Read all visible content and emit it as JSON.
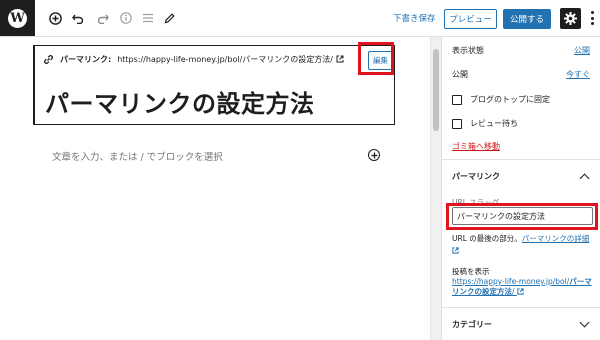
{
  "toolbar": {
    "logo_glyph": "W",
    "save_draft": "下書き保存",
    "preview": "プレビュー",
    "publish": "公開する"
  },
  "editor": {
    "permalink_label": "パーマリンク:",
    "permalink_url": "https://happy-life-money.jp/bol/パーマリンクの設定方法/",
    "edit_button": "編集",
    "post_title": "パーマリンクの設定方法",
    "block_placeholder": "文章を入力、または / でブロックを選択"
  },
  "sidebar": {
    "visibility_label": "表示状態",
    "visibility_value": "公開",
    "publish_label": "公開",
    "publish_value": "今すぐ",
    "stick_to_top": "ブログのトップに固定",
    "pending_review": "レビュー待ち",
    "move_to_trash": "ゴミ箱へ移動",
    "permalink_panel_title": "パーマリンク",
    "url_slug_label": "URL スラッグ",
    "url_slug_value": "パーマリンクの設定方法",
    "slug_help_prefix": "URL の最後の部分。",
    "slug_help_link": "パーマリンクの詳細",
    "view_post_label": "投稿を表示",
    "view_post_url_base": "https://happy-life-money.jp/bol/",
    "view_post_url_slug": "パーマリンクの設定方法",
    "view_post_url_suffix": "/",
    "categories_panel_title": "カテゴリー"
  },
  "colors": {
    "accent": "#2271b1",
    "highlight": "#e0141e",
    "trash": "#cc1818",
    "dark": "#1e1e1e"
  },
  "icons": [
    "wordpress-logo-icon",
    "add-block-icon",
    "undo-icon",
    "redo-icon",
    "info-icon",
    "list-view-icon",
    "edit-pencil-icon",
    "gear-icon",
    "more-options-icon",
    "link-icon",
    "external-link-icon",
    "chevron-up-icon",
    "chevron-down-icon"
  ]
}
